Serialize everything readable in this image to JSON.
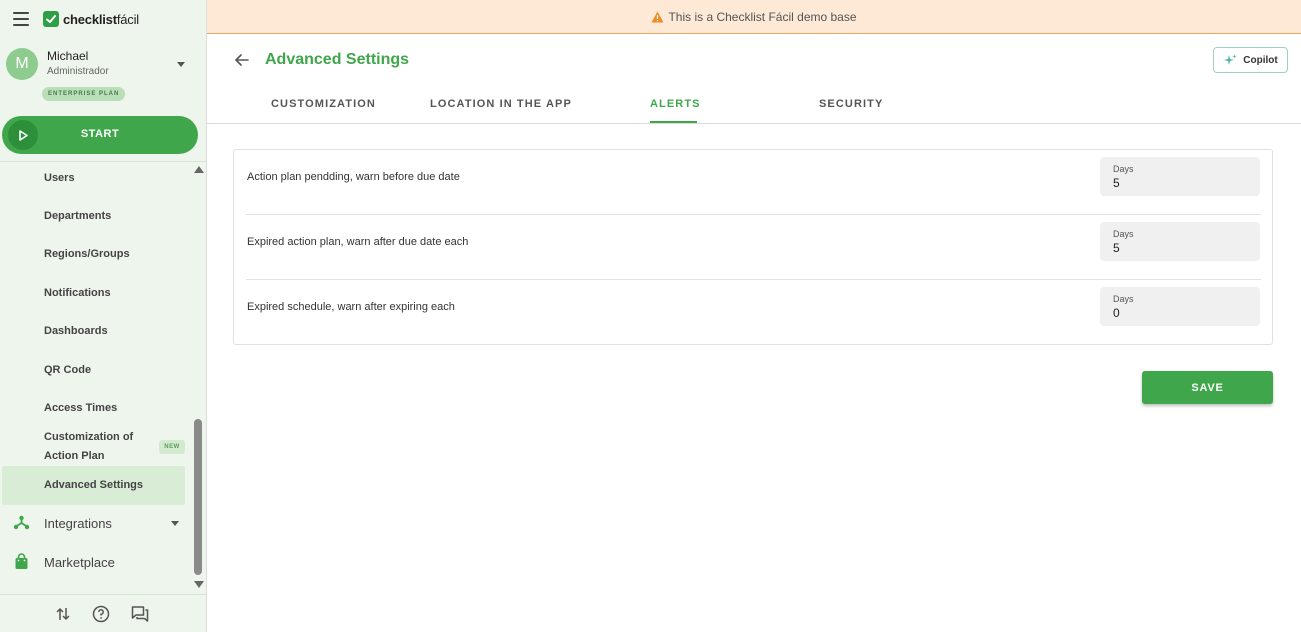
{
  "app": {
    "logo_bold": "checklist",
    "logo_light": "fácil"
  },
  "user": {
    "initial": "M",
    "name": "Michael",
    "role": "Administrador",
    "plan": "ENTERPRISE PLAN"
  },
  "start": {
    "label": "START"
  },
  "sidebar": {
    "items": [
      {
        "label": "Users"
      },
      {
        "label": "Departments"
      },
      {
        "label": "Regions/Groups"
      },
      {
        "label": "Notifications"
      },
      {
        "label": "Dashboards"
      },
      {
        "label": "QR Code"
      },
      {
        "label": "Access Times"
      },
      {
        "label": "Customization of Action Plan",
        "line1": "Customization of",
        "line2": "Action Plan",
        "badge": "NEW"
      },
      {
        "label": "Advanced Settings",
        "active": true
      }
    ],
    "integrations": "Integrations",
    "marketplace": "Marketplace",
    "accent_color": "#3fa64b"
  },
  "banner": {
    "text": "This is a Checklist Fácil demo base"
  },
  "header": {
    "title": "Advanced Settings",
    "copilot_label": "Copilot"
  },
  "tabs": [
    {
      "label": "CUSTOMIZATION"
    },
    {
      "label": "LOCATION IN THE APP"
    },
    {
      "label": "ALERTS",
      "active": true
    },
    {
      "label": "SECURITY"
    }
  ],
  "alerts": {
    "rows": [
      {
        "label": "Action plan pendding, warn before due date",
        "field_label": "Days",
        "value": "5"
      },
      {
        "label": "Expired action plan, warn after due date each",
        "field_label": "Days",
        "value": "5"
      },
      {
        "label": "Expired schedule, warn after expiring each",
        "field_label": "Days",
        "value": "0"
      }
    ]
  },
  "actions": {
    "save_label": "SAVE"
  }
}
